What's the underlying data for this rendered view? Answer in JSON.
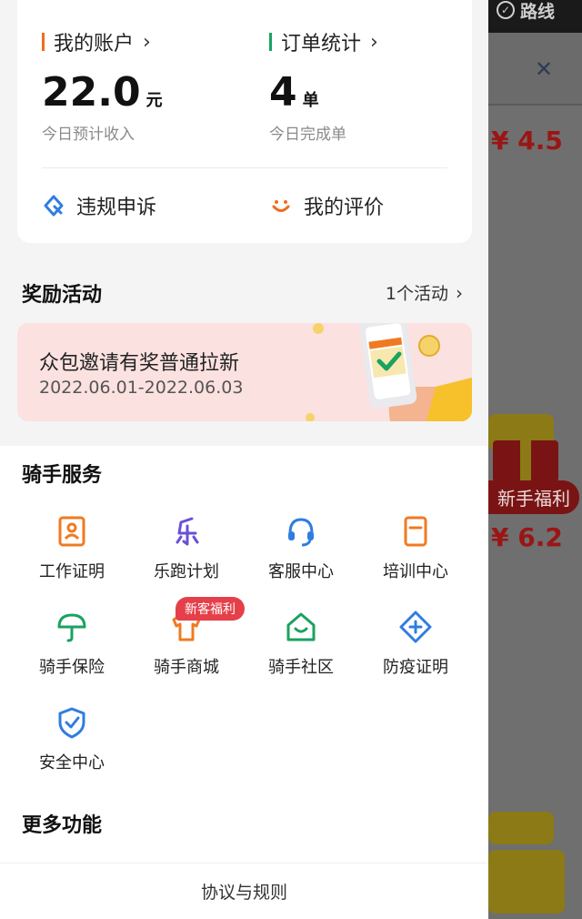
{
  "background": {
    "route_label": "路线",
    "prices": [
      "¥ 4.5",
      "¥ 6.2"
    ],
    "newbie_badge": "新手福利"
  },
  "account": {
    "my_account": {
      "title": "我的账户",
      "value": "22.0",
      "unit": "元",
      "sub": "今日预计收入",
      "accent": "#f26b1d"
    },
    "order_stats": {
      "title": "订单统计",
      "value": "4",
      "unit": "单",
      "sub": "今日完成单",
      "accent": "#1aa260"
    },
    "appeal": "违规申诉",
    "my_review": "我的评价"
  },
  "rewards": {
    "title": "奖励活动",
    "count_label": "1个活动",
    "banner_title": "众包邀请有奖普通拉新",
    "banner_dates": "2022.06.01-2022.06.03"
  },
  "services": {
    "title": "骑手服务",
    "new_tag": "新客福利",
    "items": [
      {
        "label": "工作证明",
        "icon": "id-card-icon",
        "color": "#f07a22"
      },
      {
        "label": "乐跑计划",
        "icon": "run-plan-icon",
        "color": "#6a4fd8"
      },
      {
        "label": "客服中心",
        "icon": "headset-icon",
        "color": "#2f7de1"
      },
      {
        "label": "培训中心",
        "icon": "training-icon",
        "color": "#f07a22"
      },
      {
        "label": "骑手保险",
        "icon": "umbrella-icon",
        "color": "#1aa260"
      },
      {
        "label": "骑手商城",
        "icon": "shop-shirt-icon",
        "color": "#f07a22"
      },
      {
        "label": "骑手社区",
        "icon": "community-house-icon",
        "color": "#1aa260"
      },
      {
        "label": "防疫证明",
        "icon": "medical-plus-icon",
        "color": "#2f7de1"
      },
      {
        "label": "安全中心",
        "icon": "shield-check-icon",
        "color": "#2f7de1"
      }
    ]
  },
  "more": {
    "title": "更多功能"
  },
  "footer": {
    "rules": "协议与规则"
  }
}
